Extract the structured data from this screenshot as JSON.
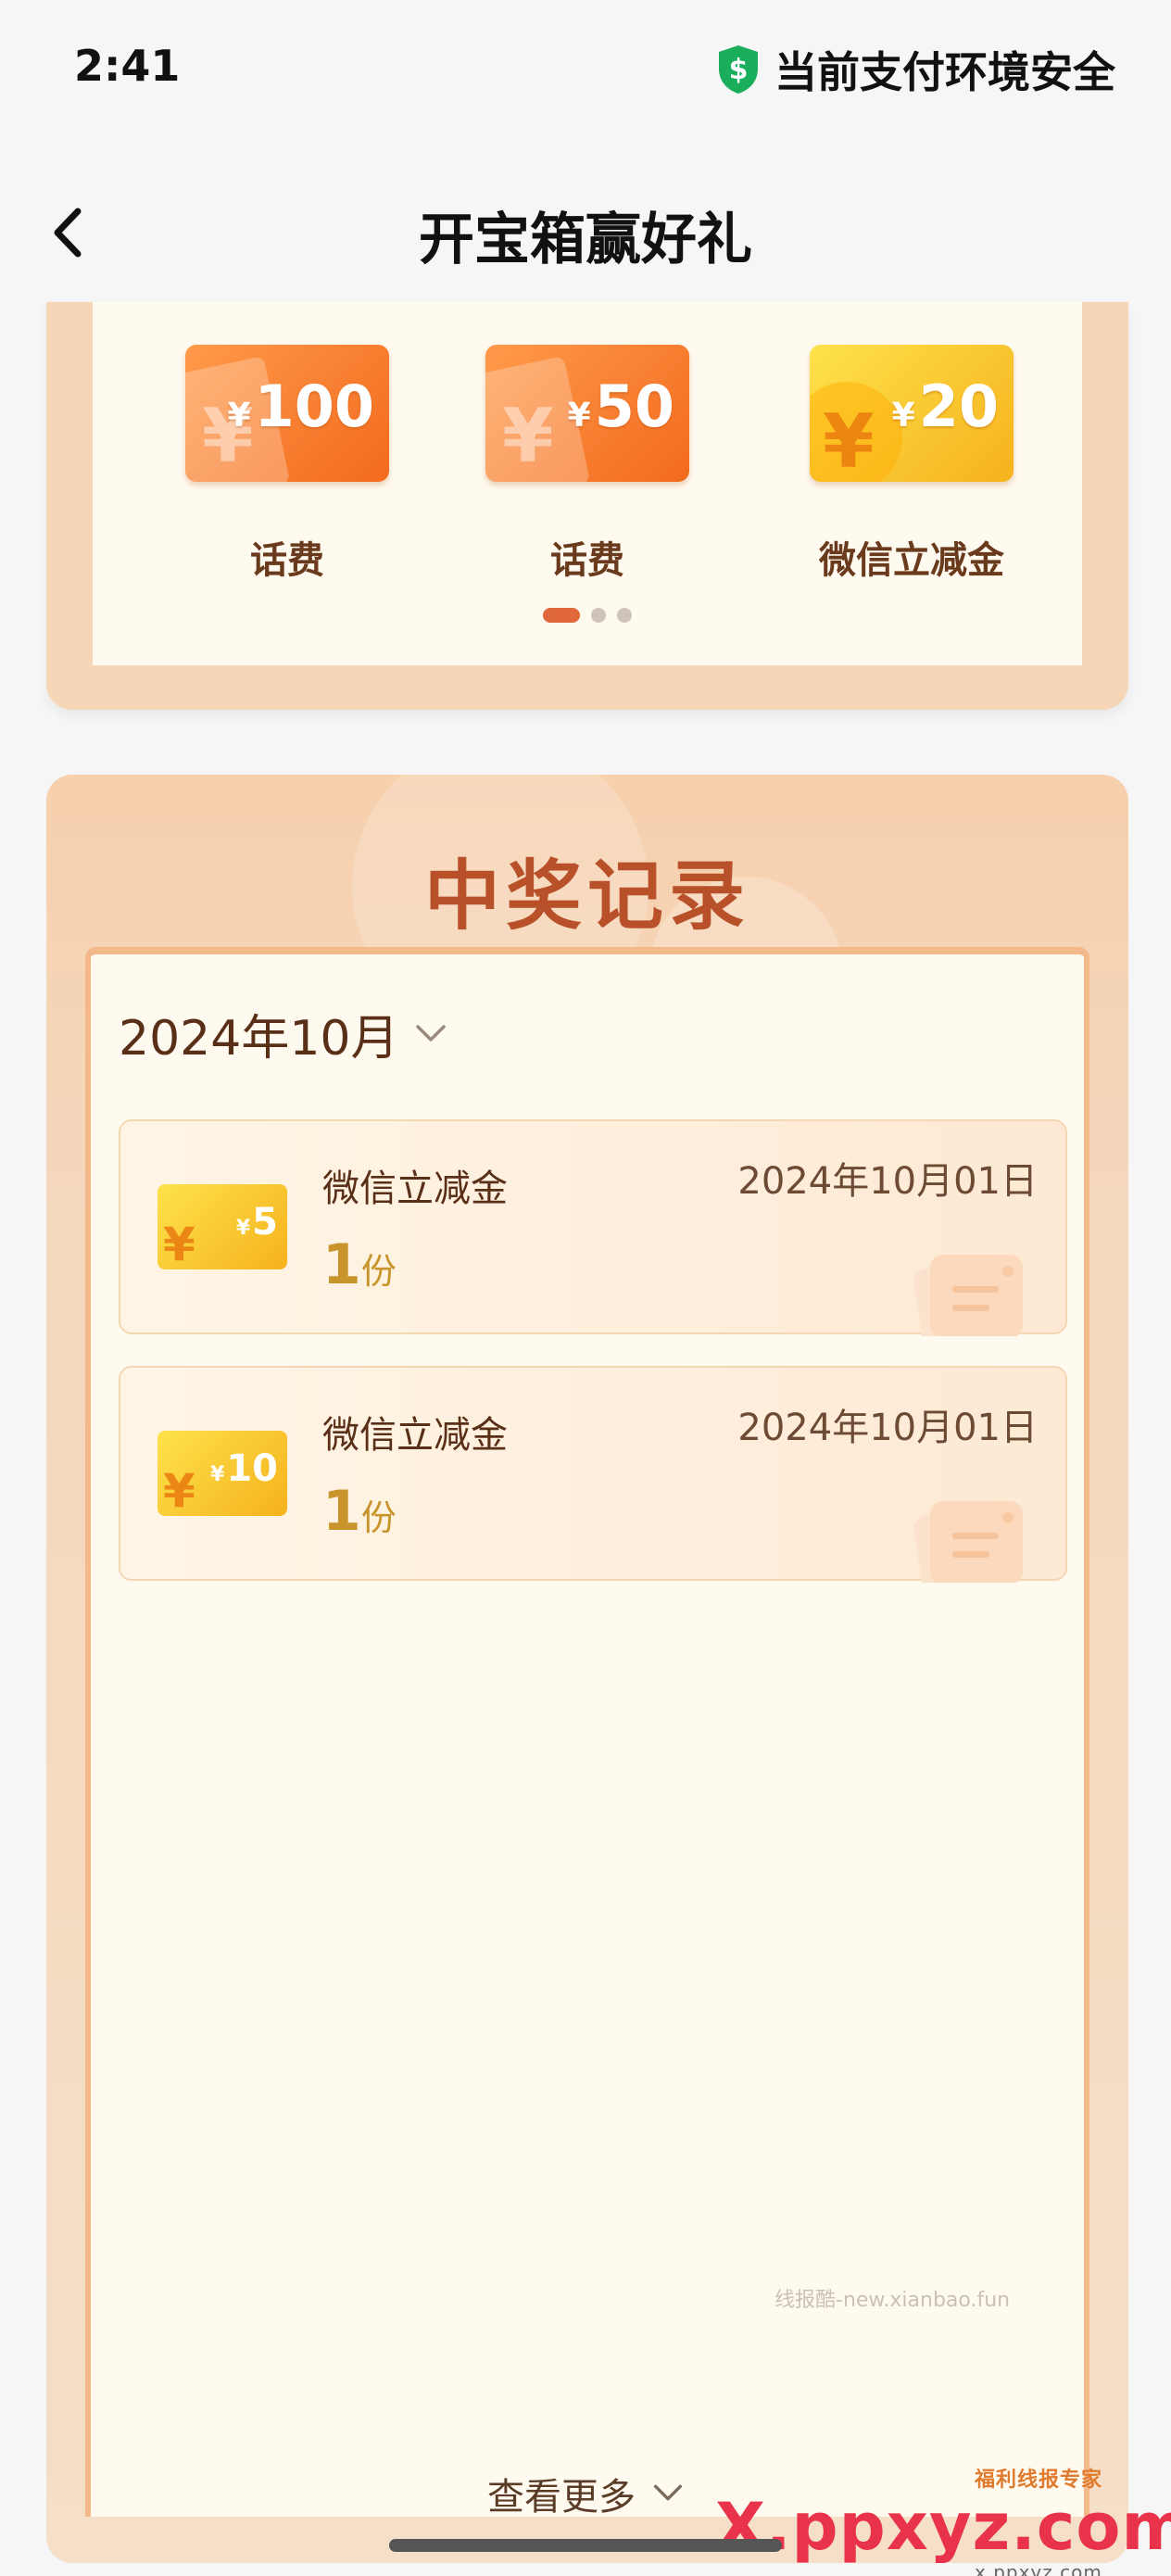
{
  "status_bar": {
    "time": "2:41",
    "security_text": "当前支付环境安全",
    "shield_icon": "shield-dollar-icon",
    "shield_color": "#1aad5c"
  },
  "nav": {
    "title": "开宝箱赢好礼",
    "back_icon": "chevron-left-icon"
  },
  "prizes": {
    "items": [
      {
        "symbol": "¥",
        "amount": "100",
        "label": "话费",
        "style": "orange"
      },
      {
        "symbol": "¥",
        "amount": "50",
        "label": "话费",
        "style": "orange"
      },
      {
        "symbol": "¥",
        "amount": "20",
        "label": "微信立减金",
        "style": "gold"
      }
    ],
    "page_count": 3,
    "active_page": 1
  },
  "records": {
    "title": "中奖记录",
    "month": "2024年10月",
    "items": [
      {
        "name": "微信立减金",
        "coupon_symbol": "¥",
        "coupon_amount": "5",
        "quantity": "1",
        "unit": "份",
        "date": "2024年10月01日"
      },
      {
        "name": "微信立减金",
        "coupon_symbol": "¥",
        "coupon_amount": "10",
        "quantity": "1",
        "unit": "份",
        "date": "2024年10月01日"
      }
    ],
    "watermark": "线报酷-new.xianbao.fun",
    "view_more": "查看更多"
  },
  "overlay": {
    "site_logo": "X.ppxyz.com",
    "site_tagline": "福利线报专家",
    "site_sub": "x.ppxyz.com"
  },
  "colors": {
    "accent": "#e0683a",
    "title_brown": "#b8502a",
    "page_bg": "#f6f6f6"
  }
}
